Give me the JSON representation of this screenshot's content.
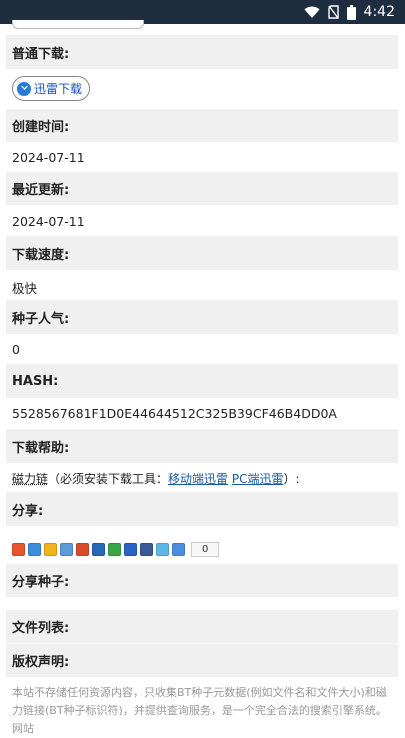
{
  "status_bar": {
    "time": "4:42"
  },
  "sections": {
    "normal_download": "普通下载:",
    "created_time": "创建时间:",
    "recent_update": "最近更新:",
    "download_speed": "下载速度:",
    "seed_popularity": "种子人气:",
    "hash": "HASH:",
    "download_help": "下载帮助:",
    "share": "分享:",
    "share_seed": "分享种子:",
    "file_list": "文件列表:",
    "copyright": "版权声明:"
  },
  "values": {
    "created_time": "2024-07-11",
    "recent_update": "2024-07-11",
    "download_speed": "极快",
    "seed_popularity": "0",
    "hash": "5528567681F1D0E44644512C325B39CF46B4DD0A"
  },
  "xunlei_button": {
    "label": "迅雷下载"
  },
  "help": {
    "magnet": "磁力链",
    "note": "（必须安装下载工具：",
    "mobile_link": "移动端迅雷",
    "pc_link": "PC端迅雷",
    "end": "）:"
  },
  "share": {
    "count": "0"
  },
  "disclaimer": "本站不存储任何资源内容，只收集BT种子元数据(例如文件名和文件大小)和磁力链接(BT种子标识符)，并提供查询服务，是一个完全合法的搜索引擎系统。 网站"
}
